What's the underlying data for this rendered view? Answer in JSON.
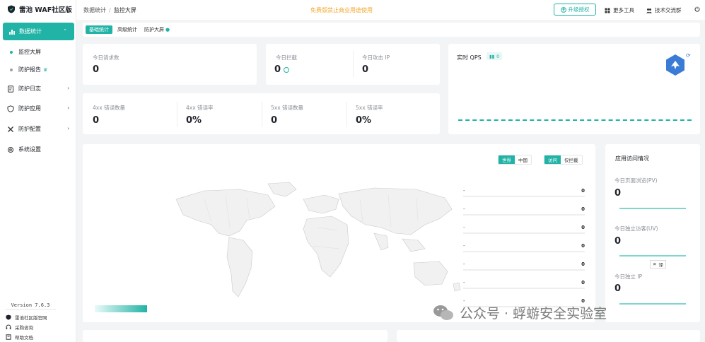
{
  "brand": {
    "name": "雷池 WAF社区版"
  },
  "sidebar": {
    "active": {
      "label": "数据统计"
    },
    "subitems": [
      {
        "label": "监控大屏"
      },
      {
        "label": "防护报告"
      }
    ],
    "items": [
      {
        "label": "防护日志"
      },
      {
        "label": "防护应用"
      },
      {
        "label": "防护配置"
      },
      {
        "label": "系统设置"
      }
    ],
    "version": "Version 7.6.3",
    "footer": [
      {
        "label": "雷池社区版官网"
      },
      {
        "label": "采购咨询"
      },
      {
        "label": "帮助文档"
      }
    ]
  },
  "header": {
    "breadcrumb": {
      "parent": "数据统计",
      "separator": "/",
      "current": "监控大屏"
    },
    "notice": "免费版禁止商业用途使用",
    "upgrade": "升级授权",
    "more_tools": "更多工具",
    "community": "技术交流群"
  },
  "tabs": [
    "基础统计",
    "高级统计",
    "防护大屏"
  ],
  "stats": {
    "today_requests": {
      "label": "今日请求数",
      "value": "0"
    },
    "today_blocks": {
      "label": "今日拦截",
      "value": "0"
    },
    "today_attack_ip": {
      "label": "今日攻击 IP",
      "value": "0"
    },
    "err4xx_count": {
      "label": "4xx 错误数量",
      "value": "0"
    },
    "err4xx_rate": {
      "label": "4xx 错误率",
      "value": "0%"
    },
    "err5xx_count": {
      "label": "5xx 错误数量",
      "value": "0"
    },
    "err5xx_rate": {
      "label": "5xx 错误率",
      "value": "0%"
    }
  },
  "qps": {
    "title": "实时 QPS",
    "value": "0"
  },
  "map": {
    "region_toggle": [
      "世界",
      "中国"
    ],
    "metric_toggle": [
      "访问",
      "仅拦截"
    ],
    "ranking": [
      {
        "name": "-",
        "value": "0"
      },
      {
        "name": "-",
        "value": "0"
      },
      {
        "name": "-",
        "value": "0"
      },
      {
        "name": "-",
        "value": "0"
      },
      {
        "name": "-",
        "value": "0"
      },
      {
        "name": "-",
        "value": "0"
      },
      {
        "name": "-",
        "value": "0"
      }
    ]
  },
  "access": {
    "title": "应用访问情况",
    "pv": {
      "label": "今日页面浏览(PV)",
      "value": "0"
    },
    "uv": {
      "label": "今日独立访客(UV)",
      "value": "0"
    },
    "ip": {
      "label": "今日独立 IP",
      "value": "0"
    },
    "chip": "译"
  },
  "watermark": "公众号 · 蜉蝣安全实验室",
  "colors": {
    "accent": "#21b3a6",
    "notice": "#f3a72b"
  }
}
